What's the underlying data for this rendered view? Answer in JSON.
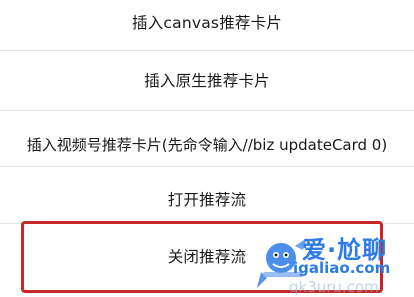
{
  "menu": {
    "items": [
      {
        "label": "插入canvas推荐卡片"
      },
      {
        "label": "插入原生推荐卡片"
      },
      {
        "label": "插入视频号推荐卡片(先命令输入//biz updateCard 0)"
      },
      {
        "label": "打开推荐流"
      },
      {
        "label": "关闭推荐流"
      }
    ],
    "highlighted_index": 4,
    "highlight_color": "#c62828"
  },
  "watermark": {
    "brand": "爱·尬聊",
    "url": "igaliao.com",
    "sub": "qk3uru.com",
    "brand_color": "#2d7be5",
    "icon": "mascot-logo-icon"
  }
}
